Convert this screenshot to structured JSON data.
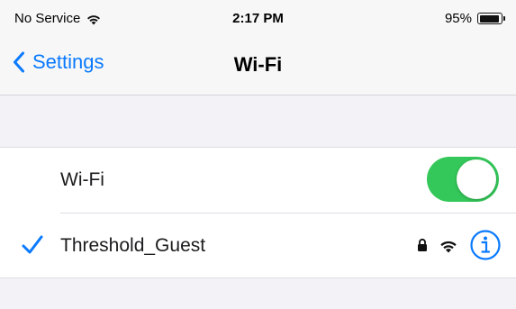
{
  "status_bar": {
    "carrier": "No Service",
    "time": "2:17 PM",
    "battery_percent": "95%",
    "battery_level": 0.95
  },
  "nav": {
    "back_label": "Settings",
    "title": "Wi-Fi"
  },
  "wifi_row": {
    "label": "Wi-Fi",
    "enabled": true
  },
  "network_row": {
    "name": "Threshold_Guest",
    "connected": true,
    "secured": true
  },
  "colors": {
    "accent": "#0a7aff",
    "toggle_on": "#34c759",
    "group_background": "#f2f2f7"
  },
  "icons": [
    "wifi-signal-icon",
    "battery-icon",
    "chevron-left-icon",
    "checkmark-icon",
    "lock-icon",
    "wifi-icon",
    "info-icon"
  ]
}
